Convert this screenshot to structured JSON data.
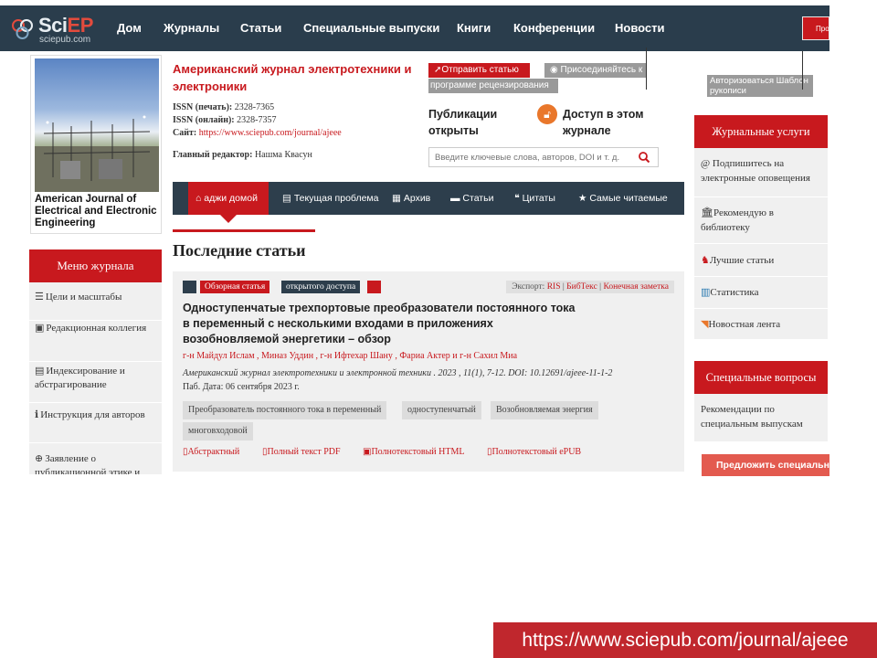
{
  "colors": {
    "nav_bg": "#2a3d4c",
    "accent_red": "#c8191e",
    "gray_btn": "#9a9a9a",
    "panel_bg": "#f0f0f0",
    "badge_orange": "#e9772b"
  },
  "logo": {
    "brand_main": "Sci",
    "brand_accent": "EP",
    "site": "sciepub.com"
  },
  "nav": {
    "items": [
      "Дом",
      "Журналы",
      "Статьи",
      "Специальные выпуски",
      "Книги",
      "Конференции",
      "Новости"
    ],
    "right_button": "Про"
  },
  "cover": {
    "title": "American Journal of Electrical and Electronic Engineering"
  },
  "journal": {
    "title": "Американский журнал электротехники и электроники",
    "issn_print_label": "ISSN (печать):",
    "issn_print": "2328-7365",
    "issn_online_label": "ISSN (онлайн):",
    "issn_online": "2328-7357",
    "site_label": "Сайт:",
    "site_url": "https://www.sciepub.com/journal/ajeee",
    "editor_label": "Главный редактор:",
    "editor": "Нашма Квасун"
  },
  "actions": {
    "submit": "Отправить статью",
    "join_line1": "Присоединяйтесь к",
    "join_line2": "программе рецензирования",
    "template": "Авторизоваться Шаблон рукописи"
  },
  "open_access": {
    "publications": "Публикации открыты",
    "access": "Доступ в этом журнале"
  },
  "search": {
    "placeholder": "Введите ключевые слова, авторов, DOI и т. д."
  },
  "left_menu": {
    "title": "Меню журнала",
    "items": [
      {
        "icon": "list-icon",
        "label": "Цели и масштабы"
      },
      {
        "icon": "users-icon",
        "label": "Редакционная коллегия"
      },
      {
        "icon": "database-icon",
        "label": "Индексирование и абстрагирование"
      },
      {
        "icon": "info-icon",
        "label": "Инструкция для авторов"
      },
      {
        "icon": "globe-icon",
        "label": "Заявление о публикационной этике и"
      }
    ]
  },
  "journal_tabs": {
    "home": "аджи домой",
    "items": [
      "Текущая проблема",
      "Архив",
      "Статьи",
      "Цитаты",
      "Самые читаемые"
    ]
  },
  "latest": {
    "title": "Последние статьи"
  },
  "article": {
    "tag_review": "Обзорная статья",
    "tag_open": "открытого доступа",
    "export_label": "Экспорт:",
    "export_ris": "RIS",
    "export_bibtex": "БибТекс",
    "export_endnote": "Конечная заметка",
    "title": "Одноступенчатые трехпортовые преобразователи постоянного тока в переменный с несколькими входами в приложениях возобновляемой энергетики – обзор",
    "authors": "г-н Майдул Ислам , Миназ Уддин , г-н Ифтехар Шану , Фариа Актер и г-н Сахил Миа",
    "citation": "Американский журнал электротехники и электронной техники . 2023 , 11(1), 7-12. DOI: 10.12691/ajeee-11-1-2",
    "date": "Паб. Дата: 06 сентября 2023 г.",
    "keywords": [
      "Преобразователь постоянного тока в переменный",
      "одноступенчатый",
      "Возобновляемая энергия",
      "многовходовой"
    ],
    "links": [
      "Абстрактный",
      "Полный текст PDF",
      "Полнотекстовый HTML",
      "Полнотекстовый ePUB"
    ]
  },
  "services": {
    "title": "Журнальные услуги",
    "items": [
      {
        "icon": "at-icon",
        "label": "Подпишитесь на электронные оповещения"
      },
      {
        "icon": "library-icon",
        "label": "Рекомендую в библиотеку"
      },
      {
        "icon": "trophy-icon",
        "label": "Лучшие статьи"
      },
      {
        "icon": "bar-chart-icon",
        "label": "Статистика"
      },
      {
        "icon": "rss-icon",
        "label": "Новостная лента"
      }
    ]
  },
  "special": {
    "title": "Специальные вопросы",
    "text": "Рекомендации по специальным выпускам",
    "propose": "Предложить специальны"
  },
  "url_banner": "https://www.sciepub.com/journal/ajeee"
}
